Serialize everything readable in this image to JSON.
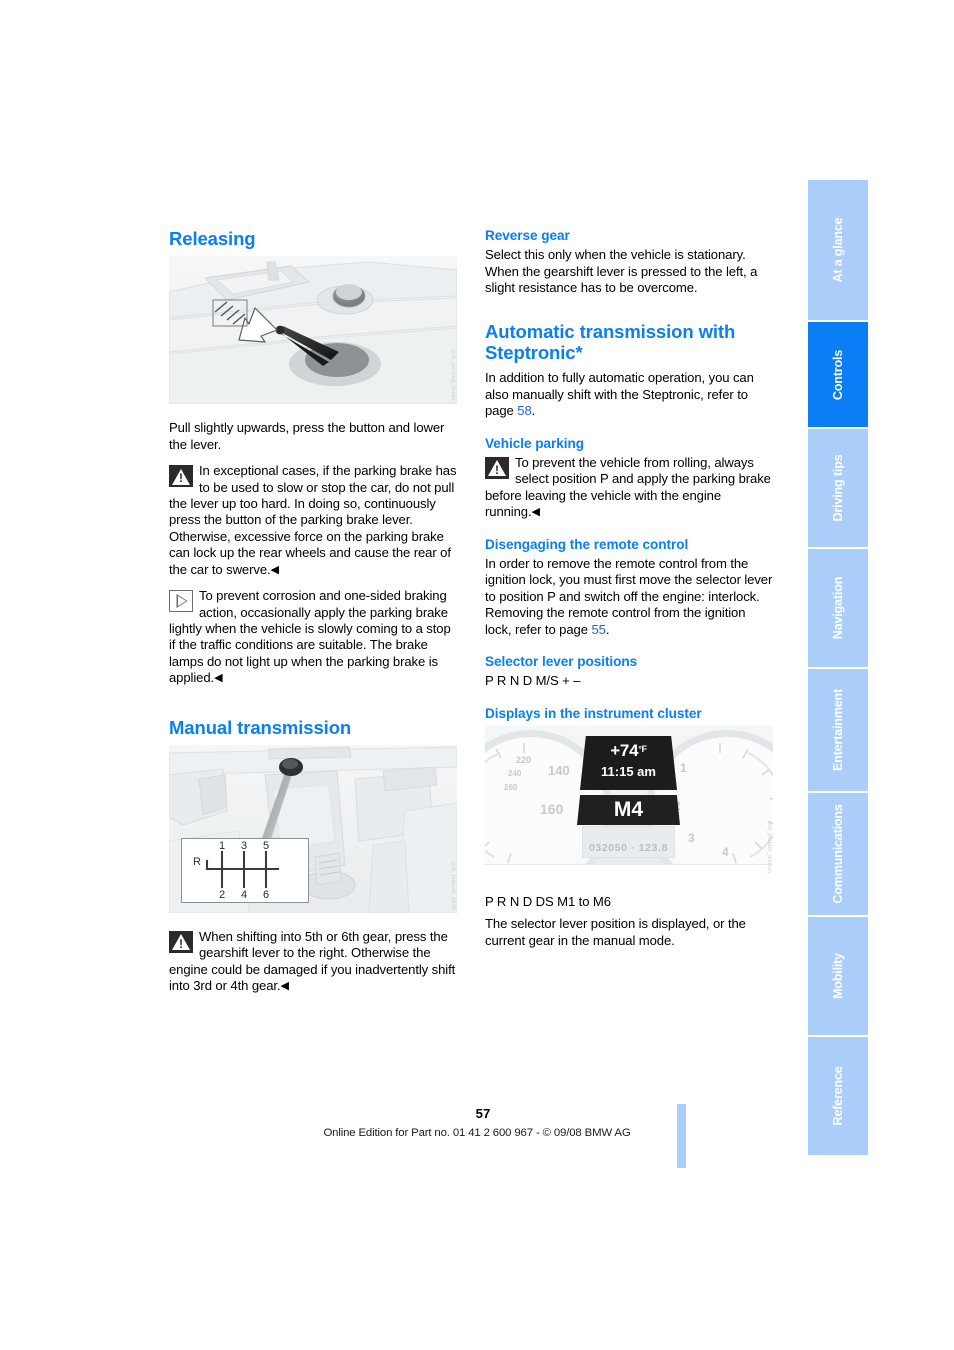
{
  "document": {
    "page_number": "57",
    "footer_note": "Online Edition for Part no. 01 41 2 600 967  - © 09/08 BMW AG",
    "accent_color": "#0a7ef5",
    "tab_inactive_color": "#abcdf9"
  },
  "index_tabs": [
    {
      "label": "At a glance",
      "active": false
    },
    {
      "label": "Controls",
      "active": true
    },
    {
      "label": "Driving tips",
      "active": false
    },
    {
      "label": "Navigation",
      "active": false
    },
    {
      "label": "Entertainment",
      "active": false
    },
    {
      "label": "Communications",
      "active": false
    },
    {
      "label": "Mobility",
      "active": false
    },
    {
      "label": "Reference",
      "active": false
    }
  ],
  "left_column": {
    "releasing": {
      "heading": "Releasing",
      "figure_credit": "pvh_parking_brake",
      "caption": "Pull slightly upwards, press the button and lower the lever.",
      "warning_note": {
        "icon": "warning-triangle-icon",
        "text": "In exceptional cases, if the parking brake has to be used to slow or stop the car, do not pull the lever up too hard. In doing so, continuously press the button of the parking brake lever.",
        "text2": "Otherwise, excessive force on the parking brake can lock up the rear wheels and cause the rear of the car to swerve.",
        "endmark": "◀"
      },
      "info_note": {
        "icon": "info-triangle-icon",
        "text": "To prevent corrosion and one-sided braking action, occasionally apply the parking brake lightly when the vehicle is slowly coming to a stop if the traffic conditions are suitable. The brake lamps do not light up when the parking brake is applied.",
        "endmark": "◀"
      }
    },
    "manual_transmission": {
      "heading": "Manual transmission",
      "figure_credit": "pvh_manual_shift",
      "gear_pattern": {
        "reverse_label": "R",
        "top_gears": [
          "1",
          "3",
          "5"
        ],
        "bottom_gears": [
          "2",
          "4",
          "6"
        ]
      },
      "warning_note": {
        "icon": "warning-triangle-icon",
        "text": "When shifting into 5th or 6th gear, press the gearshift lever to the right. Otherwise the engine could be damaged if you inadvertently shift into 3rd or 4th gear.",
        "endmark": "◀"
      }
    }
  },
  "right_column": {
    "reverse_gear": {
      "heading": "Reverse gear",
      "text": "Select this only when the vehicle is stationary. When the gearshift lever is pressed to the left, a slight resistance has to be overcome."
    },
    "automatic_transmission": {
      "heading": "Automatic transmission with Steptronic*",
      "text_before": "In addition to fully automatic operation, you can also manually shift with the Steptronic, refer to page ",
      "page_ref": "58",
      "text_after": "."
    },
    "vehicle_parking": {
      "heading": "Vehicle parking",
      "warning_note": {
        "icon": "warning-triangle-icon",
        "text": "To prevent the vehicle from rolling, always select position P and apply the parking brake before leaving the vehicle with the engine running.",
        "endmark": "◀"
      }
    },
    "disengaging_remote": {
      "heading": "Disengaging the remote control",
      "text_before": "In order to remove the remote control from the ignition lock, you must first move the selector lever to position P and switch off the engine: interlock. Removing the remote control from the ignition lock, refer to page ",
      "page_ref": "55",
      "text_after": "."
    },
    "selector_lever_positions": {
      "heading": "Selector lever positions",
      "positions": "P R N D M/S + –"
    },
    "displays_cluster": {
      "heading": "Displays in the instrument cluster",
      "figure_credit": "pvh_cluster_display",
      "cluster": {
        "temperature": "+74",
        "temperature_unit": "°F",
        "time": "11:15 am",
        "gear": "M4",
        "odometer": "032050 · 123.8",
        "left_dial_numbers": [
          "220",
          "240",
          "260",
          "140",
          "160"
        ],
        "right_dial_numbers": [
          "1",
          "2",
          "3",
          "4"
        ]
      },
      "positions": "P R N D DS M1 to M6",
      "text": "The selector lever position is displayed, or the current gear in the manual mode."
    }
  }
}
